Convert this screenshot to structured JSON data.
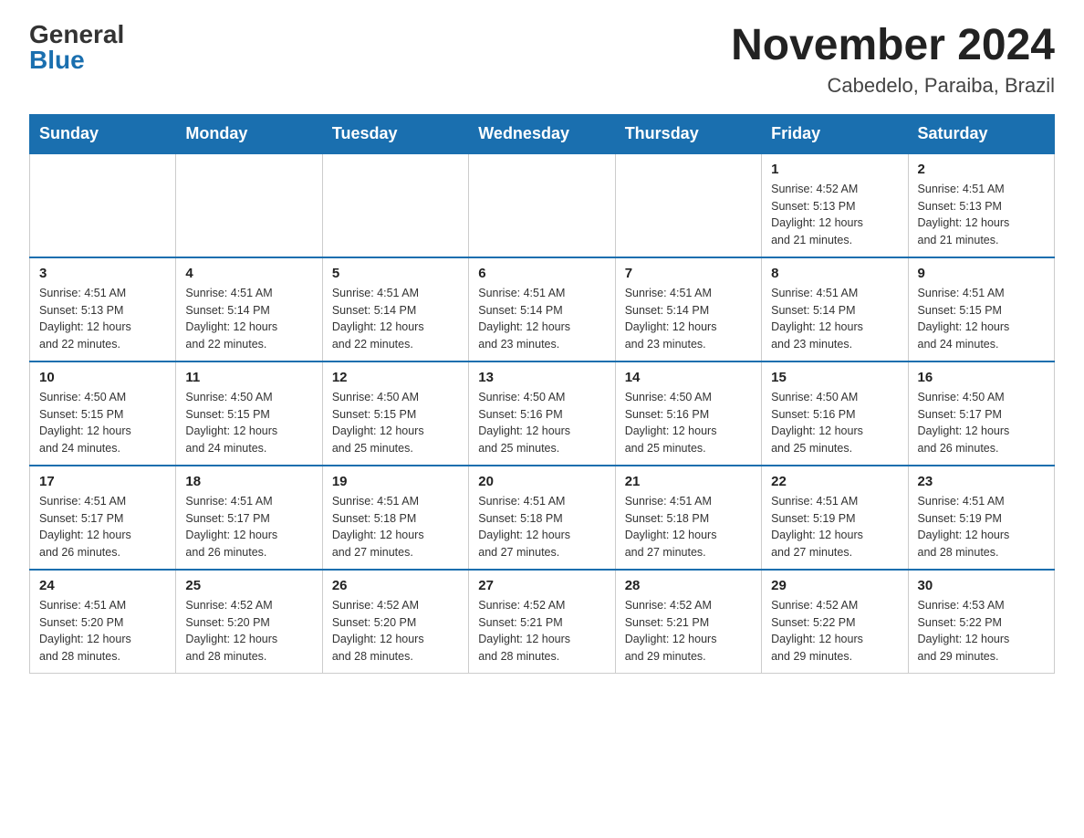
{
  "header": {
    "logo_general": "General",
    "logo_blue": "Blue",
    "month_title": "November 2024",
    "location": "Cabedelo, Paraiba, Brazil"
  },
  "calendar": {
    "days_of_week": [
      "Sunday",
      "Monday",
      "Tuesday",
      "Wednesday",
      "Thursday",
      "Friday",
      "Saturday"
    ],
    "weeks": [
      [
        {
          "day": "",
          "info": ""
        },
        {
          "day": "",
          "info": ""
        },
        {
          "day": "",
          "info": ""
        },
        {
          "day": "",
          "info": ""
        },
        {
          "day": "",
          "info": ""
        },
        {
          "day": "1",
          "info": "Sunrise: 4:52 AM\nSunset: 5:13 PM\nDaylight: 12 hours\nand 21 minutes."
        },
        {
          "day": "2",
          "info": "Sunrise: 4:51 AM\nSunset: 5:13 PM\nDaylight: 12 hours\nand 21 minutes."
        }
      ],
      [
        {
          "day": "3",
          "info": "Sunrise: 4:51 AM\nSunset: 5:13 PM\nDaylight: 12 hours\nand 22 minutes."
        },
        {
          "day": "4",
          "info": "Sunrise: 4:51 AM\nSunset: 5:14 PM\nDaylight: 12 hours\nand 22 minutes."
        },
        {
          "day": "5",
          "info": "Sunrise: 4:51 AM\nSunset: 5:14 PM\nDaylight: 12 hours\nand 22 minutes."
        },
        {
          "day": "6",
          "info": "Sunrise: 4:51 AM\nSunset: 5:14 PM\nDaylight: 12 hours\nand 23 minutes."
        },
        {
          "day": "7",
          "info": "Sunrise: 4:51 AM\nSunset: 5:14 PM\nDaylight: 12 hours\nand 23 minutes."
        },
        {
          "day": "8",
          "info": "Sunrise: 4:51 AM\nSunset: 5:14 PM\nDaylight: 12 hours\nand 23 minutes."
        },
        {
          "day": "9",
          "info": "Sunrise: 4:51 AM\nSunset: 5:15 PM\nDaylight: 12 hours\nand 24 minutes."
        }
      ],
      [
        {
          "day": "10",
          "info": "Sunrise: 4:50 AM\nSunset: 5:15 PM\nDaylight: 12 hours\nand 24 minutes."
        },
        {
          "day": "11",
          "info": "Sunrise: 4:50 AM\nSunset: 5:15 PM\nDaylight: 12 hours\nand 24 minutes."
        },
        {
          "day": "12",
          "info": "Sunrise: 4:50 AM\nSunset: 5:15 PM\nDaylight: 12 hours\nand 25 minutes."
        },
        {
          "day": "13",
          "info": "Sunrise: 4:50 AM\nSunset: 5:16 PM\nDaylight: 12 hours\nand 25 minutes."
        },
        {
          "day": "14",
          "info": "Sunrise: 4:50 AM\nSunset: 5:16 PM\nDaylight: 12 hours\nand 25 minutes."
        },
        {
          "day": "15",
          "info": "Sunrise: 4:50 AM\nSunset: 5:16 PM\nDaylight: 12 hours\nand 25 minutes."
        },
        {
          "day": "16",
          "info": "Sunrise: 4:50 AM\nSunset: 5:17 PM\nDaylight: 12 hours\nand 26 minutes."
        }
      ],
      [
        {
          "day": "17",
          "info": "Sunrise: 4:51 AM\nSunset: 5:17 PM\nDaylight: 12 hours\nand 26 minutes."
        },
        {
          "day": "18",
          "info": "Sunrise: 4:51 AM\nSunset: 5:17 PM\nDaylight: 12 hours\nand 26 minutes."
        },
        {
          "day": "19",
          "info": "Sunrise: 4:51 AM\nSunset: 5:18 PM\nDaylight: 12 hours\nand 27 minutes."
        },
        {
          "day": "20",
          "info": "Sunrise: 4:51 AM\nSunset: 5:18 PM\nDaylight: 12 hours\nand 27 minutes."
        },
        {
          "day": "21",
          "info": "Sunrise: 4:51 AM\nSunset: 5:18 PM\nDaylight: 12 hours\nand 27 minutes."
        },
        {
          "day": "22",
          "info": "Sunrise: 4:51 AM\nSunset: 5:19 PM\nDaylight: 12 hours\nand 27 minutes."
        },
        {
          "day": "23",
          "info": "Sunrise: 4:51 AM\nSunset: 5:19 PM\nDaylight: 12 hours\nand 28 minutes."
        }
      ],
      [
        {
          "day": "24",
          "info": "Sunrise: 4:51 AM\nSunset: 5:20 PM\nDaylight: 12 hours\nand 28 minutes."
        },
        {
          "day": "25",
          "info": "Sunrise: 4:52 AM\nSunset: 5:20 PM\nDaylight: 12 hours\nand 28 minutes."
        },
        {
          "day": "26",
          "info": "Sunrise: 4:52 AM\nSunset: 5:20 PM\nDaylight: 12 hours\nand 28 minutes."
        },
        {
          "day": "27",
          "info": "Sunrise: 4:52 AM\nSunset: 5:21 PM\nDaylight: 12 hours\nand 28 minutes."
        },
        {
          "day": "28",
          "info": "Sunrise: 4:52 AM\nSunset: 5:21 PM\nDaylight: 12 hours\nand 29 minutes."
        },
        {
          "day": "29",
          "info": "Sunrise: 4:52 AM\nSunset: 5:22 PM\nDaylight: 12 hours\nand 29 minutes."
        },
        {
          "day": "30",
          "info": "Sunrise: 4:53 AM\nSunset: 5:22 PM\nDaylight: 12 hours\nand 29 minutes."
        }
      ]
    ]
  }
}
